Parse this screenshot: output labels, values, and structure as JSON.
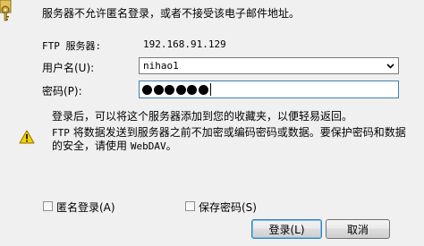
{
  "header": {
    "message": "服务器不允许匿名登录，或者不接受该电子邮件地址。"
  },
  "form": {
    "ftp_server_label": "FTP 服务器:",
    "ftp_server_value": "192.168.91.129",
    "username_label": "用户名(U):",
    "username_value": "nihao1",
    "password_label": "密码(P):",
    "password_masked_length": 6
  },
  "hint": "登录后，可以将这个服务器添加到您的收藏夹，以便轻易返回。",
  "warning": {
    "line1_prefix": "FTP",
    "line1_text": " 将数据发送到服务器之前不加密或编码密码或数据。要保护密码和数据",
    "line2_text": "的安全，请使用 ",
    "line2_suffix": "WebDAV",
    "line2_end": "。"
  },
  "options": {
    "anonymous_label": "匿名登录(A)",
    "anonymous_checked": false,
    "save_password_label": "保存密码(S)",
    "save_password_checked": false
  },
  "buttons": {
    "login_label": "登录(L)",
    "cancel_label": "取消"
  },
  "colors": {
    "background": "#f0f0f0",
    "focus_border": "#3c7fb1",
    "warning_yellow": "#f5d000"
  },
  "icons": {
    "top_left": "key-icon",
    "warning": "warning-icon",
    "dropdown": "chevron-down-icon"
  }
}
